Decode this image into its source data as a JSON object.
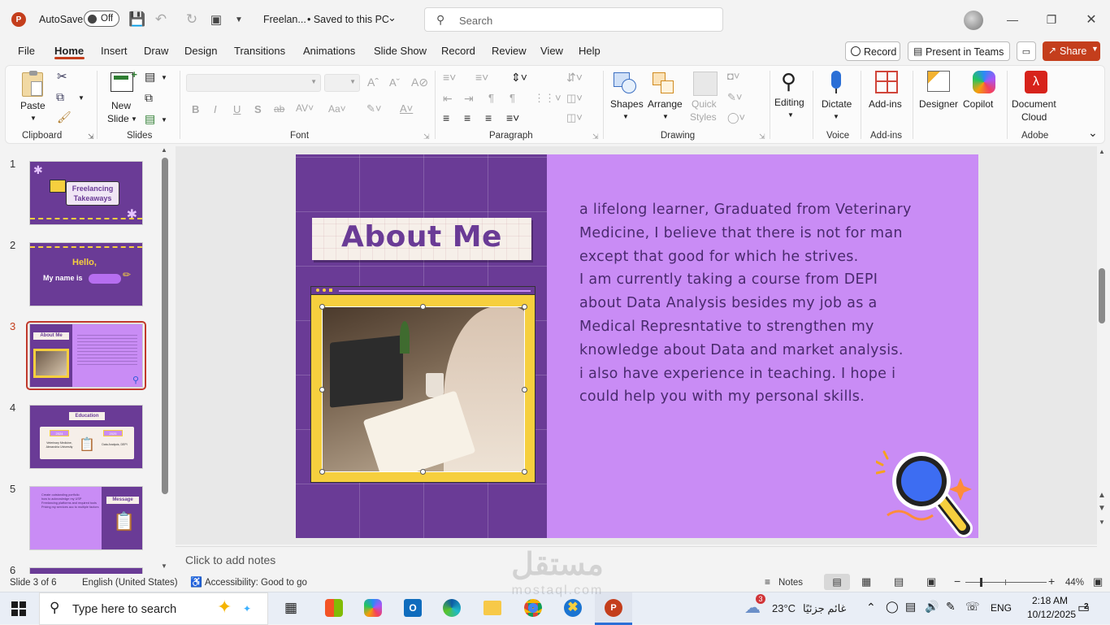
{
  "titlebar": {
    "autosave_label": "AutoSave",
    "autosave_state": "Off",
    "doc_title": "Freelan...",
    "doc_status": "• Saved to this PC",
    "search_placeholder": "Search"
  },
  "menu": {
    "tabs": [
      "File",
      "Home",
      "Insert",
      "Draw",
      "Design",
      "Transitions",
      "Animations",
      "Slide Show",
      "Record",
      "Review",
      "View",
      "Help"
    ],
    "active": "Home",
    "record_btn": "Record",
    "present_btn": "Present in Teams",
    "share_btn": "Share"
  },
  "ribbon": {
    "clipboard": {
      "paste": "Paste",
      "label": "Clipboard"
    },
    "slides": {
      "new_slide": "New Slide",
      "new_slide_line1": "New",
      "new_slide_line2": "Slide",
      "label": "Slides"
    },
    "font": {
      "label": "Font"
    },
    "paragraph": {
      "label": "Paragraph"
    },
    "drawing": {
      "shapes": "Shapes",
      "arrange": "Arrange",
      "quick_styles_1": "Quick",
      "quick_styles_2": "Styles",
      "label": "Drawing"
    },
    "editing": {
      "label": "Editing"
    },
    "voice": {
      "dictate": "Dictate",
      "label": "Voice"
    },
    "addins": {
      "addins": "Add-ins",
      "label": "Add-ins"
    },
    "designer": "Designer",
    "copilot": "Copilot",
    "adobe": {
      "doc_cloud_1": "Document",
      "doc_cloud_2": "Cloud",
      "label": "Adobe"
    }
  },
  "thumbnails": [
    {
      "num": "1",
      "text1": "Freelancing",
      "text2": "Takeaways"
    },
    {
      "num": "2",
      "text1": "Hello,",
      "text2": "My name is"
    },
    {
      "num": "3",
      "text1": "About Me"
    },
    {
      "num": "4",
      "text1": "Education",
      "text2": "2024",
      "text3": "2025",
      "text4": "Veterinary Medicine, Alexandria University",
      "text5": "Data Analysis, DEPI"
    },
    {
      "num": "5",
      "text1": "Message",
      "items": [
        "Create outstanding portfolio",
        "how to acknowledge my USP",
        "Freelancing platforms and required tools",
        "Pricing my services acc to multiple factors"
      ]
    },
    {
      "num": "6"
    }
  ],
  "active_slide": 3,
  "slide": {
    "title": "About Me",
    "body": [
      "a lifelong learner, Graduated from Veterinary",
      "Medicine, I believe that there is not for man",
      "except that good for which he strives.",
      "I am currently taking a course from DEPI",
      "about Data Analysis besides my job as a",
      "Medical Represntative to strengthen my",
      "knowledge about Data and market analysis.",
      "i also have experience in teaching. I hope i",
      "could help you with my personal skills."
    ]
  },
  "notes_placeholder": "Click to add notes",
  "status": {
    "slide_pos": "Slide 3 of 6",
    "language": "English (United States)",
    "accessibility": "Accessibility: Good to go",
    "notes": "Notes",
    "zoom": "44%"
  },
  "taskbar": {
    "search": "Type here to search",
    "weather_temp": "23°C",
    "weather_desc": "غائم جزئيًا",
    "weather_badge": "3",
    "lang": "ENG",
    "time": "2:18 AM",
    "date": "10/12/2025",
    "notif_count": "2"
  },
  "watermark": {
    "arabic": "مستقل",
    "latin": "mostaql.com"
  },
  "colors": {
    "accent_ppt": "#c43e1c",
    "slide_dark": "#6a3b96",
    "slide_light": "#c98cf5",
    "title_text": "#6a3b96",
    "frame_yellow": "#f6cf3e",
    "body_text": "#4a2a6e"
  }
}
